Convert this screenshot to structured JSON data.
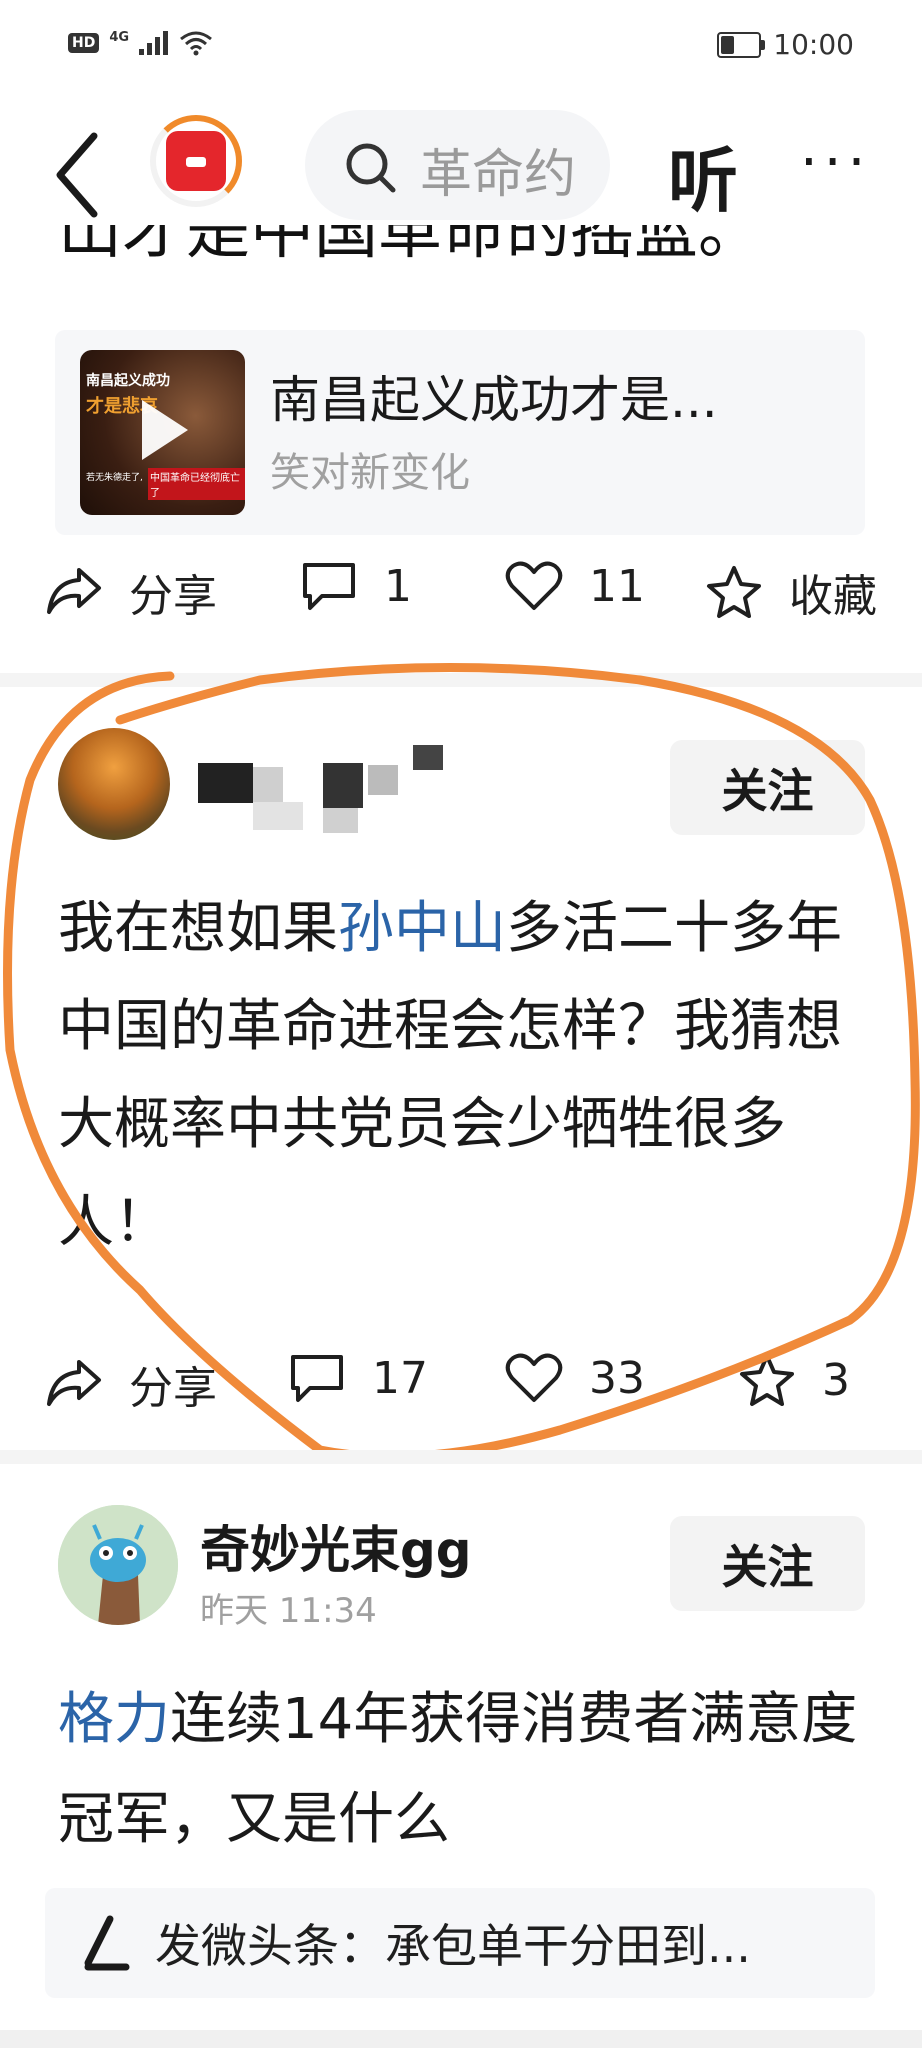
{
  "status_bar": {
    "left_labels": [
      "HD",
      "4G"
    ],
    "time": "10:00",
    "battery_level": 0.35
  },
  "nav": {
    "search_text": "革命约",
    "listen_label": "听",
    "more_label": "···"
  },
  "previous_post": {
    "cut_text": "山才是中国革命的摇篮。",
    "video": {
      "thumb_line1": "南昌起义成功",
      "thumb_line2": "才是悲哀",
      "thumb_line3": "若无朱德走了,",
      "thumb_line4": "中国革命已经彻底亡了",
      "title": "南昌起义成功才是...",
      "author": "笑对新变化"
    },
    "actions": {
      "share": "分享",
      "comments": "1",
      "likes": "11",
      "favorite": "收藏"
    }
  },
  "highlighted_post": {
    "follow_label": "关注",
    "body_before": "我在想如果",
    "body_highlight": "孙中山",
    "body_after": "多活二十多年中国的革命进程会怎样？我猜想大概率中共党员会少牺牲很多人！",
    "actions": {
      "share": "分享",
      "comments": "17",
      "likes": "33",
      "favorite": "3"
    },
    "annotation_color": "#f08a3a"
  },
  "next_post": {
    "author": "奇妙光束gg",
    "time": "昨天  11:34",
    "follow_label": "关注",
    "body_highlight": "格力",
    "body_after": "连续14年获得消费者满意度冠军，又是什么",
    "quote_text": "发微头条：承包单干分田到..."
  }
}
